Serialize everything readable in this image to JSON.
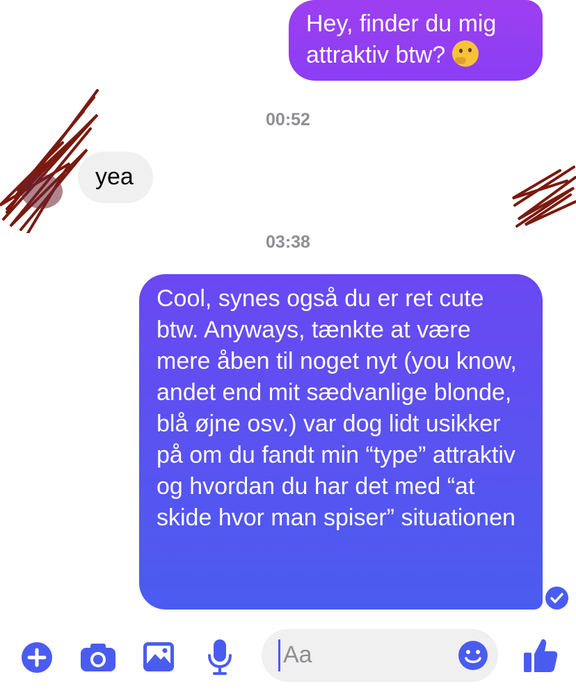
{
  "messages": {
    "m1": {
      "text": "Hey, finder du mig attraktiv btw? "
    },
    "t1": {
      "text": "00:52"
    },
    "m2": {
      "text": "yea"
    },
    "t2": {
      "text": "03:38"
    },
    "m3": {
      "text": "Cool, synes også du er ret cute btw. Anyways, tænkte at være mere åben til noget nyt (you know, andet end mit sædvanlige blonde, blå øjne osv.) var dog lidt usikker på om du fandt min “type” attraktiv og hvordan du har det med “at skide hvor man spiser” situationen"
    }
  },
  "composer": {
    "placeholder": "Aa"
  },
  "icons": [
    "plus-circle-icon",
    "camera-icon",
    "image-icon",
    "microphone-icon",
    "emoji-icon",
    "thumbs-up-icon",
    "thinking-face-emoji",
    "seen-check-icon"
  ],
  "colors": {
    "accent": "#4a5cf0",
    "purple": "#8a3ef4",
    "gray_bubble": "#f0f0f0",
    "timestamp": "#8e8e93",
    "scribble": "#7a1a10"
  }
}
